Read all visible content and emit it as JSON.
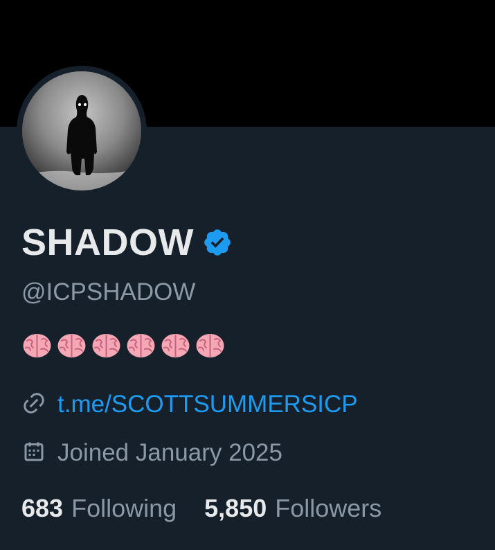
{
  "profile": {
    "display_name": "SHADOW",
    "handle": "@ICPSHADOW",
    "verified": true,
    "bio_emoji": [
      "brain",
      "brain",
      "brain",
      "brain",
      "brain",
      "brain"
    ],
    "link": "t.me/SCOTTSUMMERSICP",
    "joined": "Joined January 2025"
  },
  "stats": {
    "following_count": "683",
    "following_label": "Following",
    "followers_count": "5,850",
    "followers_label": "Followers"
  },
  "colors": {
    "background": "#15202b",
    "banner": "#000000",
    "primary_text": "#e7e9ea",
    "secondary_text": "#8b98a5",
    "link": "#1d9bf0",
    "verified_badge": "#1d9bf0"
  },
  "icons": {
    "verified": "verified-badge-icon",
    "link": "link-icon",
    "calendar": "calendar-icon",
    "bio": "brain-icon"
  }
}
